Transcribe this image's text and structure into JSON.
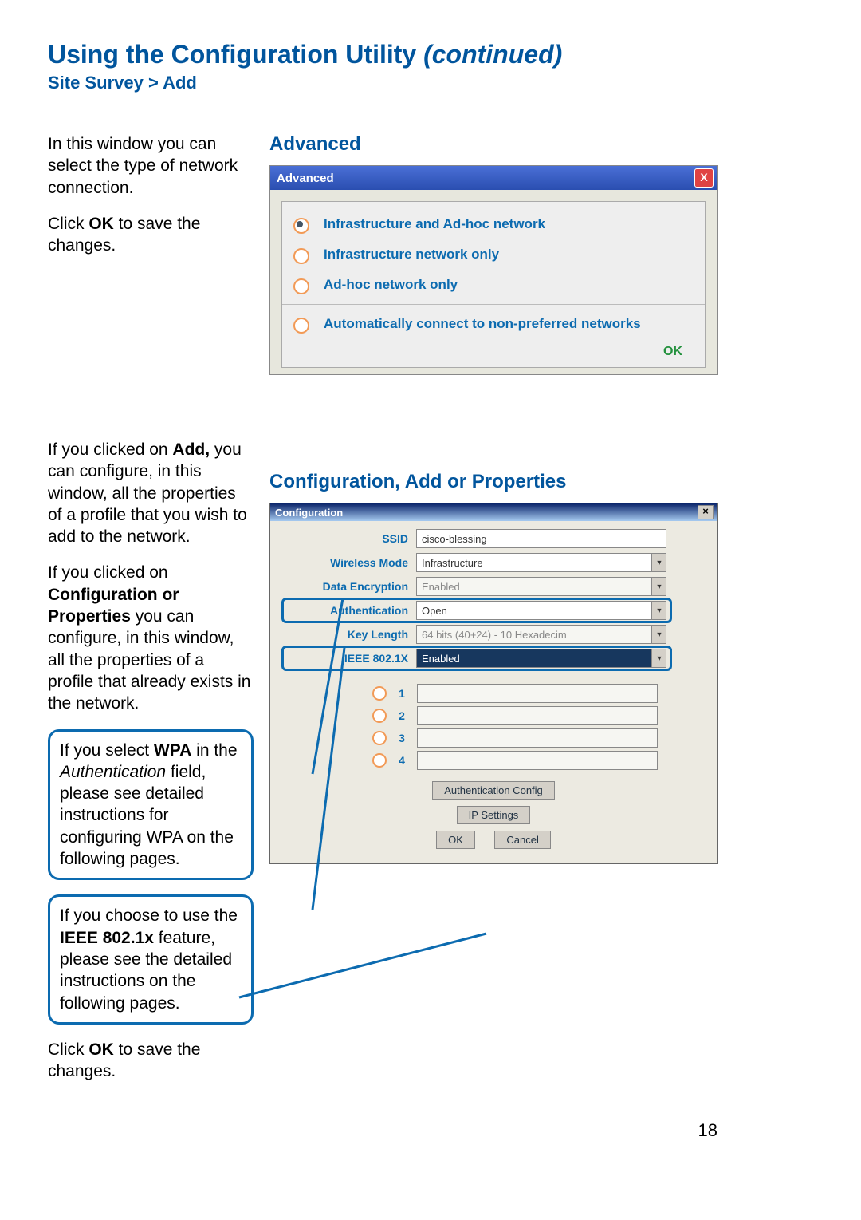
{
  "page_title_main": "Using the Configuration Utility ",
  "page_title_cont": "(continued)",
  "breadcrumb": "Site Survey > Add",
  "section1": {
    "heading": "Advanced",
    "p1a": "In this window you can select the type of network connection.",
    "p2a": "Click ",
    "p2b": "OK",
    "p2c": " to save the changes."
  },
  "adv_window": {
    "title": "Advanced",
    "close": "X",
    "options": [
      "Infrastructure and Ad-hoc network",
      "Infrastructure  network only",
      "Ad-hoc network only"
    ],
    "opt4": "Automatically connect to non-preferred networks",
    "ok": "OK"
  },
  "section2": {
    "heading": "Configuration, Add or Properties",
    "p1a": "If you clicked on ",
    "p1b": "Add,",
    "p1c": " you can configure, in this window, all the properties of a profile that you wish to add to the network.",
    "p2a": "If you clicked on ",
    "p2b": "Configuration or Properties",
    "p2c": " you can configure, in this window, all the properties of a profile that already exists in the network.",
    "c1a": "If you select ",
    "c1b": "WPA",
    "c1c": " in the ",
    "c1d": "Authentication",
    "c1e": " field, please see detailed instructions for configuring WPA on the following pages.",
    "c2a": "If you choose to use the ",
    "c2b": "IEEE 802.1x",
    "c2c": " feature, please see the detailed instructions on the following pages.",
    "p3a": "Click ",
    "p3b": "OK",
    "p3c": " to save the changes."
  },
  "cfg_window": {
    "title": "Configuration",
    "close": "×",
    "rows": {
      "ssid_label": "SSID",
      "ssid_value": "cisco-blessing",
      "mode_label": "Wireless Mode",
      "mode_value": "Infrastructure",
      "enc_label": "Data Encryption",
      "enc_value": "Enabled",
      "auth_label": "Authentication",
      "auth_value": "Open",
      "keylen_label": "Key Length",
      "keylen_value": "64 bits (40+24) - 10 Hexadecim",
      "ieee_label": "IEEE 802.1X",
      "ieee_value": "Enabled"
    },
    "keys": [
      "1",
      "2",
      "3",
      "4"
    ],
    "btn_auth": "Authentication Config",
    "btn_ip": "IP Settings",
    "btn_ok": "OK",
    "btn_cancel": "Cancel"
  },
  "page_number": "18"
}
